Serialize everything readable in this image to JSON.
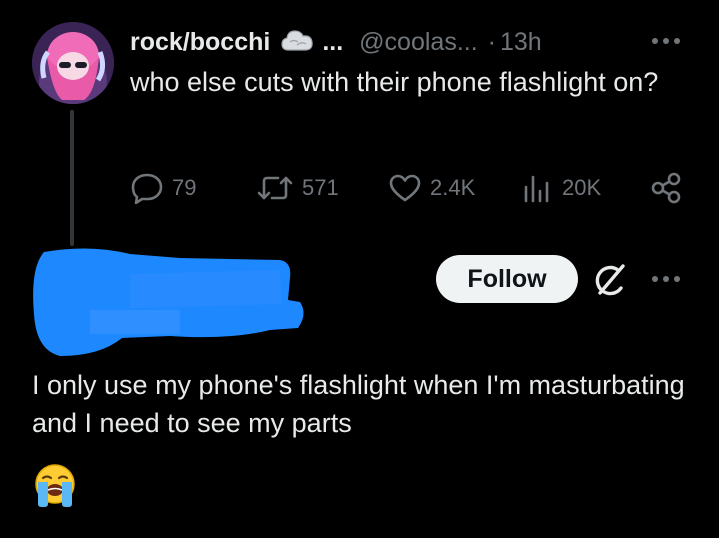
{
  "post": {
    "display_name": "rock/bocchi",
    "badge_icon": "cloud-emoji-icon",
    "name_truncation": "...",
    "handle": "@coolas...",
    "separator": "·",
    "time": "13h",
    "text": "who else cuts with their phone flashlight on?",
    "actions": {
      "replies": "79",
      "reposts": "571",
      "likes": "2.4K",
      "views": "20K"
    }
  },
  "reply": {
    "author_redacted": true,
    "follow_label": "Follow",
    "text": "I only use my phone's flashlight when I'm masturbating and I need to see my parts",
    "emoji": "😭",
    "emoji_icon": "loudly-crying-face-icon"
  },
  "colors": {
    "background": "#000000",
    "text_primary": "#e7e9ea",
    "text_secondary": "#71767b",
    "follow_button_bg": "#eff3f4",
    "redaction_blue": "#1e88ff"
  }
}
